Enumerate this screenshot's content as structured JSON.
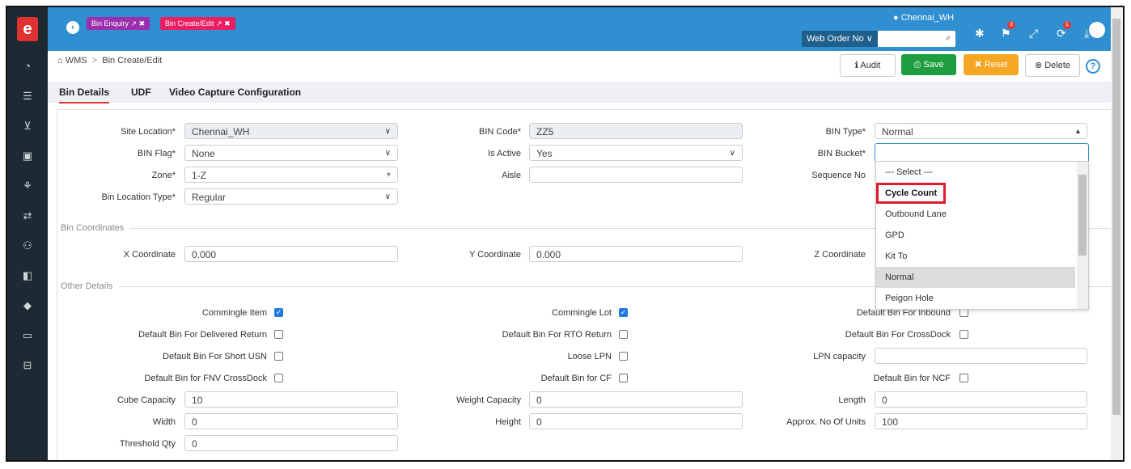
{
  "sidebar": {
    "logo": "e",
    "icons": [
      "dashboard-icon",
      "list-icon",
      "cart-icon",
      "briefcase-icon",
      "network-icon",
      "transfer-icon",
      "user-add-icon",
      "tag-icon",
      "diamond-icon",
      "card-icon",
      "inbox-icon"
    ]
  },
  "topbar": {
    "tabs": [
      {
        "label": "Bin Enquiry ↗ ✖",
        "color": "#9b2fae"
      },
      {
        "label": "Bin Create/Edit ↗ ✖",
        "color": "#e91e63"
      }
    ],
    "location": "● Chennai_WH",
    "order_type": "Web Order No ∨",
    "search_placeholder": "",
    "search_icon": "⌕",
    "notif_badge_1": "3",
    "notif_badge_2": "1"
  },
  "breadcrumb": {
    "home": "⌂ WMS",
    "sep": ">",
    "current": "Bin Create/Edit"
  },
  "actions": {
    "audit": "ℹ Audit",
    "save": "⎙ Save",
    "reset": "✖ Reset",
    "delete": "⊗ Delete",
    "help": "?"
  },
  "tabs": [
    "Bin Details",
    "UDF",
    "Video Capture Configuration"
  ],
  "form": {
    "site_location": {
      "label": "Site Location*",
      "value": "Chennai_WH"
    },
    "bin_code": {
      "label": "BIN Code*",
      "value": "ZZ5"
    },
    "bin_type": {
      "label": "BIN Type*",
      "value": "Normal"
    },
    "bin_flag": {
      "label": "BIN Flag*",
      "value": "None"
    },
    "is_active": {
      "label": "Is Active",
      "value": "Yes"
    },
    "bin_bucket": {
      "label": "BIN Bucket*",
      "value": ""
    },
    "zone": {
      "label": "Zone*",
      "value": "1-Z"
    },
    "aisle": {
      "label": "Aisle",
      "value": ""
    },
    "sequence_no": {
      "label": "Sequence No",
      "value": ""
    },
    "bin_location_type": {
      "label": "Bin Location Type*",
      "value": "Regular"
    }
  },
  "coordinates": {
    "title": "Bin Coordinates",
    "x": {
      "label": "X Coordinate",
      "value": "0.000"
    },
    "y": {
      "label": "Y Coordinate",
      "value": "0.000"
    },
    "z": {
      "label": "Z Coordinate",
      "value": ""
    }
  },
  "other": {
    "title": "Other Details",
    "commingle_item": {
      "label": "Commingle Item",
      "checked": true
    },
    "commingle_lot": {
      "label": "Commingle Lot",
      "checked": true
    },
    "default_inbound": {
      "label": "Default Bin For Inbound",
      "checked": false
    },
    "delivered_return": {
      "label": "Default Bin For Delivered Return",
      "checked": false
    },
    "rto_return": {
      "label": "Default Bin For RTO Return",
      "checked": false
    },
    "crossdock": {
      "label": "Default Bin For CrossDock",
      "checked": false
    },
    "short_usn": {
      "label": "Default Bin For Short USN",
      "checked": false
    },
    "loose_lpn": {
      "label": "Loose LPN",
      "checked": false
    },
    "lpn_capacity": {
      "label": "LPN capacity",
      "value": ""
    },
    "fnv_crossdock": {
      "label": "Default Bin for FNV CrossDock",
      "checked": false
    },
    "bin_cf": {
      "label": "Default Bin for CF",
      "checked": false
    },
    "bin_ncf": {
      "label": "Default Bin for NCF",
      "checked": false
    },
    "cube_capacity": {
      "label": "Cube Capacity",
      "value": "10"
    },
    "weight_capacity": {
      "label": "Weight Capacity",
      "value": "0"
    },
    "length": {
      "label": "Length",
      "value": "0"
    },
    "width": {
      "label": "Width",
      "value": "0"
    },
    "height": {
      "label": "Height",
      "value": "0"
    },
    "approx_units": {
      "label": "Approx. No Of Units",
      "value": "100"
    },
    "threshold_qty": {
      "label": "Threshold Qty",
      "value": "0"
    }
  },
  "bin_bucket_dropdown": {
    "options": [
      "--- Select ---",
      "Cycle Count",
      "Outbound Lane",
      "GPD",
      "Kit To",
      "Normal",
      "Peigon Hole"
    ],
    "highlighted": "Cycle Count",
    "hovered": "Normal"
  }
}
